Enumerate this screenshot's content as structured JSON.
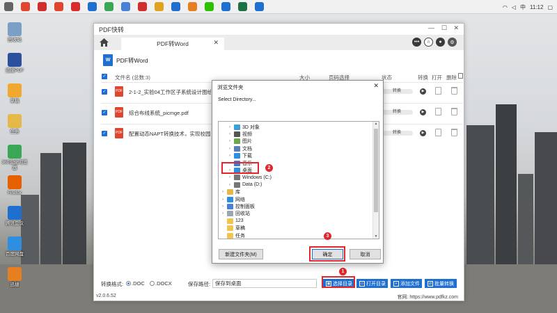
{
  "taskbar": {
    "items": [
      {
        "icon": "search-icon",
        "color": "#666666"
      },
      {
        "icon": "recorder-icon",
        "color": "#e0452d"
      },
      {
        "icon": "music-icon",
        "color": "#d22d2d"
      },
      {
        "icon": "netease-icon",
        "color": "#e0452d"
      },
      {
        "icon": "pdf-icon",
        "color": "#d82b2b"
      },
      {
        "icon": "edge-icon",
        "color": "#1f6fd1"
      },
      {
        "icon": "chrome-icon",
        "color": "#3aa757"
      },
      {
        "icon": "app-icon",
        "color": "#4a7fd6"
      },
      {
        "icon": "video-icon",
        "color": "#d22d2d"
      },
      {
        "icon": "qq-icon",
        "color": "#e0a21c"
      },
      {
        "icon": "monitor-icon",
        "color": "#1f6fd1"
      },
      {
        "icon": "app-icon",
        "color": "#e67e22"
      },
      {
        "icon": "wechat-icon",
        "color": "#2dc100"
      },
      {
        "icon": "app-icon",
        "color": "#1f6fd1"
      },
      {
        "icon": "excel-icon",
        "color": "#1e7145"
      },
      {
        "icon": "pdfkz-icon",
        "color": "#1f6fd1"
      }
    ],
    "tray": {
      "ime": "中",
      "time": "11:12"
    }
  },
  "desktop": [
    {
      "label": "回收站",
      "color": "#7aa0c8",
      "icon": "recycle-bin-icon"
    },
    {
      "label": "迅捷PDF",
      "color": "#2c4f9e",
      "icon": "app-icon"
    },
    {
      "label": "草稿",
      "color": "#f0a830",
      "icon": "folder-icon"
    },
    {
      "label": "任务",
      "color": "#e6b84a",
      "icon": "folder-icon"
    },
    {
      "label": "360安全浏览器",
      "color": "#3aa757",
      "icon": "browser-icon"
    },
    {
      "label": "Firefox",
      "color": "#e66000",
      "icon": "firefox-icon"
    },
    {
      "label": "腾讯会议",
      "color": "#1f6fd1",
      "icon": "meeting-icon"
    },
    {
      "label": "百度网盘",
      "color": "#2e8fe0",
      "icon": "cloud-icon"
    },
    {
      "label": "迅捷",
      "color": "#e67e22",
      "icon": "app-icon"
    }
  ],
  "app": {
    "title": "PDF快转",
    "tab": "PDF转Word",
    "mode_title": "PDF转Word",
    "word_icon_text": "W",
    "columns": {
      "name": "文件名 (总数:3)",
      "size": "大小",
      "pages": "页码选择",
      "status": "状态",
      "convert": "转换",
      "open": "打开",
      "delete": "删除"
    },
    "files": [
      {
        "name": "2-1-2_实验04工作区子系统设计图绘制.pdf",
        "status": "转换"
      },
      {
        "name": "综合布线系统_picmge.pdf",
        "status": "转换"
      },
      {
        "name": "配置动态NAPT转换技术，实现校园网接入",
        "status": "转换"
      }
    ],
    "format_label": "转换格式:",
    "format_options": [
      ".DOC",
      ".DOCX"
    ],
    "save_label": "保存路径:",
    "save_path": "保存到桌面",
    "buttons": {
      "choose_dir": "选择目录",
      "open_dir": "打开目录",
      "add_file": "添加文件",
      "batch": "批量转换"
    },
    "version": "v2.0.6.52",
    "website_label": "官网:",
    "website": "https://www.pdfkz.com"
  },
  "dialog": {
    "title": "浏览文件夹",
    "subtitle": "Select Directory...",
    "tree": [
      {
        "label": "3D 对象",
        "expanded": false,
        "color": "#3aa0d8",
        "icon": "3d-objects-icon"
      },
      {
        "label": "视频",
        "expanded": false,
        "color": "#555555",
        "icon": "video-folder-icon"
      },
      {
        "label": "图片",
        "expanded": false,
        "color": "#6aa84f",
        "icon": "pictures-icon"
      },
      {
        "label": "文档",
        "expanded": false,
        "color": "#5b7fb5",
        "icon": "documents-icon"
      },
      {
        "label": "下载",
        "expanded": false,
        "color": "#2e8fe0",
        "icon": "download-icon"
      },
      {
        "label": "音乐",
        "expanded": false,
        "color": "#3a7bd5",
        "icon": "music-folder-icon"
      },
      {
        "label": "桌面",
        "expanded": false,
        "color": "#2e8fe0",
        "icon": "desktop-folder-icon"
      },
      {
        "label": "Windows (C:)",
        "expanded": false,
        "color": "#777777",
        "icon": "drive-icon"
      },
      {
        "label": "Data (D:)",
        "expanded": false,
        "color": "#777777",
        "icon": "drive-icon"
      },
      {
        "label": "库",
        "expanded": false,
        "color": "#e6b84a",
        "icon": "library-icon"
      },
      {
        "label": "网络",
        "expanded": false,
        "color": "#2e8fe0",
        "icon": "network-icon"
      },
      {
        "label": "控制面板",
        "expanded": false,
        "color": "#4a7fd6",
        "icon": "control-panel-icon"
      },
      {
        "label": "回收站",
        "expanded": false,
        "color": "#9aa5b1",
        "icon": "recycle-bin-icon"
      },
      {
        "label": "123",
        "expanded": false,
        "color": "#f2c44d",
        "icon": "folder-icon"
      },
      {
        "label": "草稿",
        "expanded": false,
        "color": "#f2c44d",
        "icon": "folder-icon"
      },
      {
        "label": "任务",
        "expanded": false,
        "color": "#f2c44d",
        "icon": "folder-icon"
      }
    ],
    "buttons": {
      "new_folder": "新建文件夹(M)",
      "ok": "确定",
      "cancel": "取消"
    }
  },
  "annotations": [
    "1",
    "2",
    "3"
  ],
  "colors": {
    "accent": "#1f6fd1",
    "highlight": "#e3262c"
  }
}
